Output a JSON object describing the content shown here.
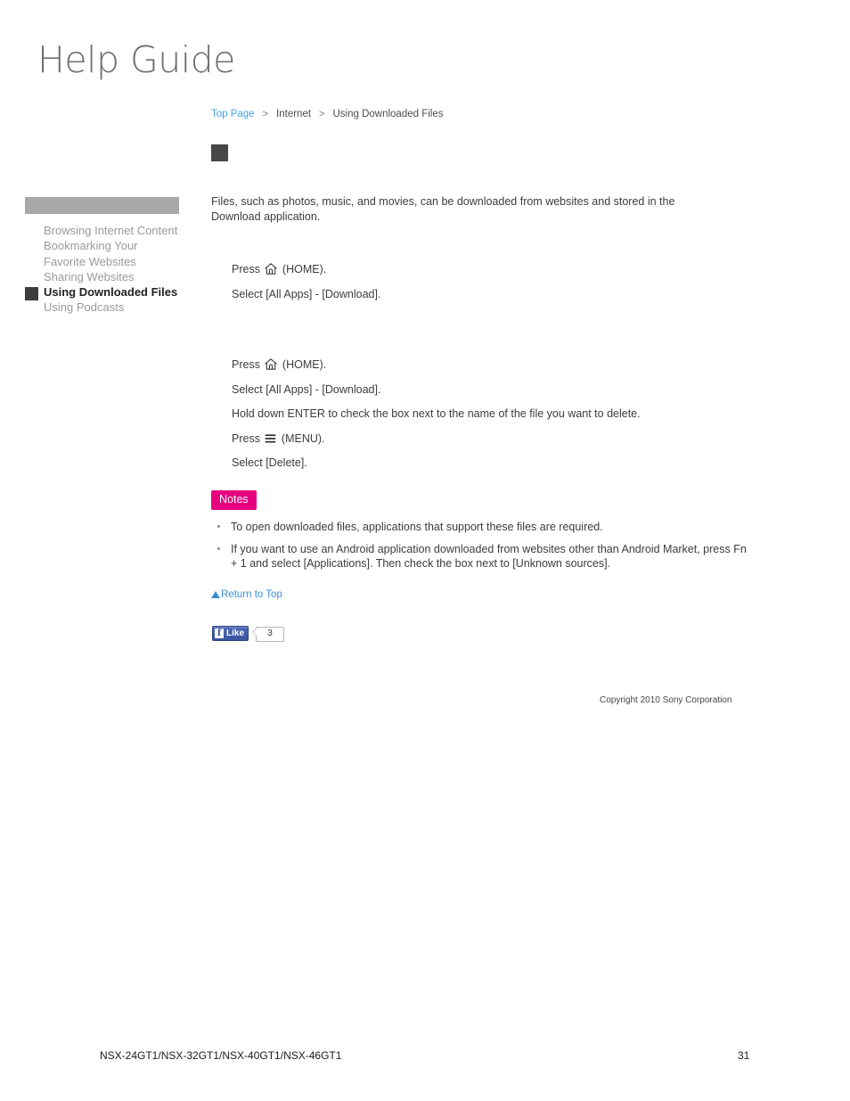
{
  "logo": {
    "text": "Help Guide"
  },
  "breadcrumb": {
    "separator": ">",
    "items": [
      {
        "label": "Top Page",
        "is_link": true
      },
      {
        "label": "Internet",
        "is_link": false
      },
      {
        "label": "Using Downloaded Files",
        "is_link": false
      }
    ]
  },
  "sidebar": {
    "items": [
      {
        "label": "Browsing Internet Content",
        "active": false
      },
      {
        "label": "Bookmarking Your Favorite Websites",
        "active": false
      },
      {
        "label": "Sharing Websites",
        "active": false
      },
      {
        "label": "Using Downloaded Files",
        "active": true
      },
      {
        "label": "Using Podcasts",
        "active": false
      }
    ]
  },
  "content": {
    "intro": "Files, such as photos, music, and movies, can be downloaded from websites and stored in the Download application.",
    "procedure_one": [
      {
        "before": "Press ",
        "icon": "home-icon",
        "after": " (HOME)."
      },
      {
        "before": "Select [All Apps] - [Download].",
        "icon": null,
        "after": ""
      }
    ],
    "procedure_two": [
      {
        "before": "Press ",
        "icon": "home-icon",
        "after": " (HOME)."
      },
      {
        "before": "Select [All Apps] - [Download].",
        "icon": null,
        "after": ""
      },
      {
        "before": "Hold down ENTER to check the box next to the name of the file you want to delete.",
        "icon": null,
        "after": ""
      },
      {
        "before": "Press ",
        "icon": "menu-icon",
        "after": " (MENU)."
      },
      {
        "before": "Select [Delete].",
        "icon": null,
        "after": ""
      }
    ]
  },
  "notes": {
    "badge_label": "Notes",
    "badge_color": "#e6007e",
    "items": [
      "To open downloaded files, applications that support these files are required.",
      "If you want to use an Android application downloaded from websites other than Android Market, press Fn + 1 and select [Applications]. Then check the box next to [Unknown sources]."
    ]
  },
  "return_to_top": {
    "label": "Return to Top",
    "color": "#3a8fd4"
  },
  "facebook_like": {
    "button_label": "Like",
    "icon_letter": "f",
    "count": "3"
  },
  "copyright": {
    "text": "Copyright 2010 Sony Corporation"
  },
  "page_footer": {
    "models": "NSX-24GT1/NSX-32GT1/NSX-40GT1/NSX-46GT1",
    "page_number": "31"
  }
}
